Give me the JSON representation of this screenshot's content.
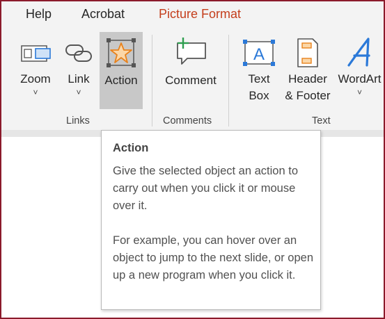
{
  "tabs": [
    {
      "label": "Help"
    },
    {
      "label": "Acrobat"
    },
    {
      "label": "Picture Format"
    }
  ],
  "groups": {
    "links": {
      "label": "Links",
      "zoom": {
        "label": "Zoom"
      },
      "link": {
        "label": "Link"
      },
      "action": {
        "label": "Action"
      }
    },
    "comments": {
      "label": "Comments",
      "comment": {
        "label": "Comment"
      }
    },
    "text": {
      "label": "Text",
      "textbox": {
        "line1": "Text",
        "line2": "Box"
      },
      "header_footer": {
        "line1": "Header",
        "line2": "& Footer"
      },
      "wordart": {
        "label": "WordArt"
      }
    }
  },
  "caret": "˅",
  "tooltip": {
    "title": "Action",
    "para1": "Give the selected object an action to carry out when you click it or mouse over it.",
    "para2": "For example, you can hover over an object to jump to the next slide, or open up a new program when you click it."
  },
  "colors": {
    "active_tab": "#c43e1c",
    "frame": "#8b1a2b",
    "accent_blue": "#2b79d8",
    "accent_orange": "#e8821c",
    "accent_green": "#2e9e4f"
  }
}
